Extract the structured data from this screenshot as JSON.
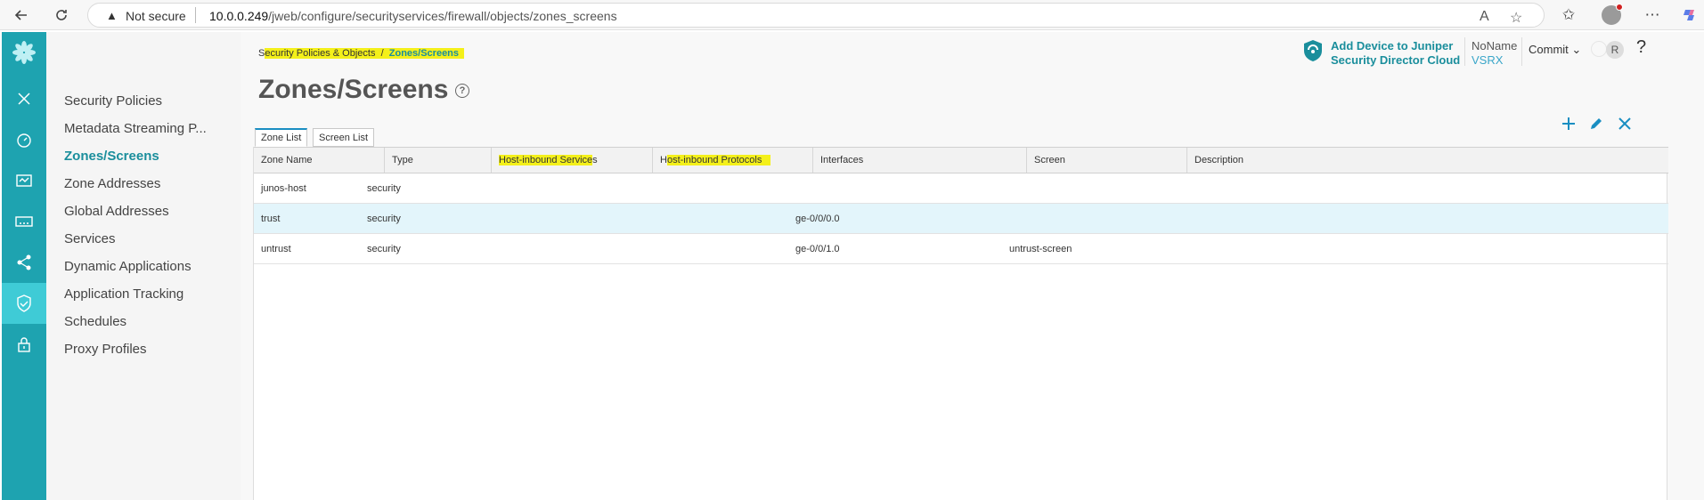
{
  "browser": {
    "not_secure": "Not secure",
    "url_host": "10.0.0.249",
    "url_path": "/jweb/configure/securityservices/firewall/objects/zones_screens"
  },
  "rail": {
    "items": [
      "logo-icon",
      "close-icon",
      "dashboard-icon",
      "monitor-icon",
      "devices-icon",
      "network-icon",
      "security-icon",
      "lock-icon"
    ],
    "active_index": 6,
    "active_color": "#3fcbd6",
    "rail_color": "#1ea3b0"
  },
  "sidenav": {
    "items": [
      {
        "label": "Security Policies"
      },
      {
        "label": "Metadata Streaming P..."
      },
      {
        "label": "Zones/Screens"
      },
      {
        "label": "Zone Addresses"
      },
      {
        "label": "Global Addresses"
      },
      {
        "label": "Services"
      },
      {
        "label": "Dynamic Applications"
      },
      {
        "label": "Application Tracking"
      },
      {
        "label": "Schedules"
      },
      {
        "label": "Proxy Profiles"
      }
    ],
    "active_index": 2
  },
  "breadcrumb": {
    "parent_lead": "S",
    "parent_rest": "ecurity Policies & Objects",
    "separator": "/",
    "current": "Zones/Screens"
  },
  "page": {
    "title": "Zones/Screens",
    "help": "?"
  },
  "header": {
    "sdc_line1": "Add Device to Juniper",
    "sdc_line2": "Security Director Cloud",
    "device_name": "NoName",
    "device_model": "VSRX",
    "commit_label": "Commit",
    "user_initial": "R",
    "help": "?"
  },
  "actions": [
    "add-icon",
    "edit-icon",
    "delete-icon"
  ],
  "tabs": [
    {
      "label": "Zone List",
      "active": true
    },
    {
      "label": "Screen List",
      "active": false
    }
  ],
  "grid": {
    "columns": [
      {
        "label": "Zone Name"
      },
      {
        "label": "Type"
      },
      {
        "lead": "",
        "hl": "Host-inbound Service",
        "tail": "s"
      },
      {
        "lead": "H",
        "hl": "ost-inbound Protocols",
        "tail": ""
      },
      {
        "label": "Interfaces"
      },
      {
        "label": "Screen"
      },
      {
        "label": "Description"
      }
    ],
    "rows": [
      {
        "zone": "junos-host",
        "type": "security",
        "services": "",
        "protocols": "",
        "interfaces": "",
        "screen": "",
        "description": ""
      },
      {
        "zone": "trust",
        "type": "security",
        "services": "",
        "protocols": "",
        "interfaces": "ge-0/0/0.0",
        "screen": "",
        "description": ""
      },
      {
        "zone": "untrust",
        "type": "security",
        "services": "",
        "protocols": "",
        "interfaces": "ge-0/0/1.0",
        "screen": "untrust-screen",
        "description": ""
      }
    ],
    "selected_row": 1
  },
  "colors": {
    "accent": "#1a8e9c",
    "action_blue": "#1a8ec2",
    "highlight": "#f4f01a",
    "selected_row": "#e3f5fb"
  }
}
